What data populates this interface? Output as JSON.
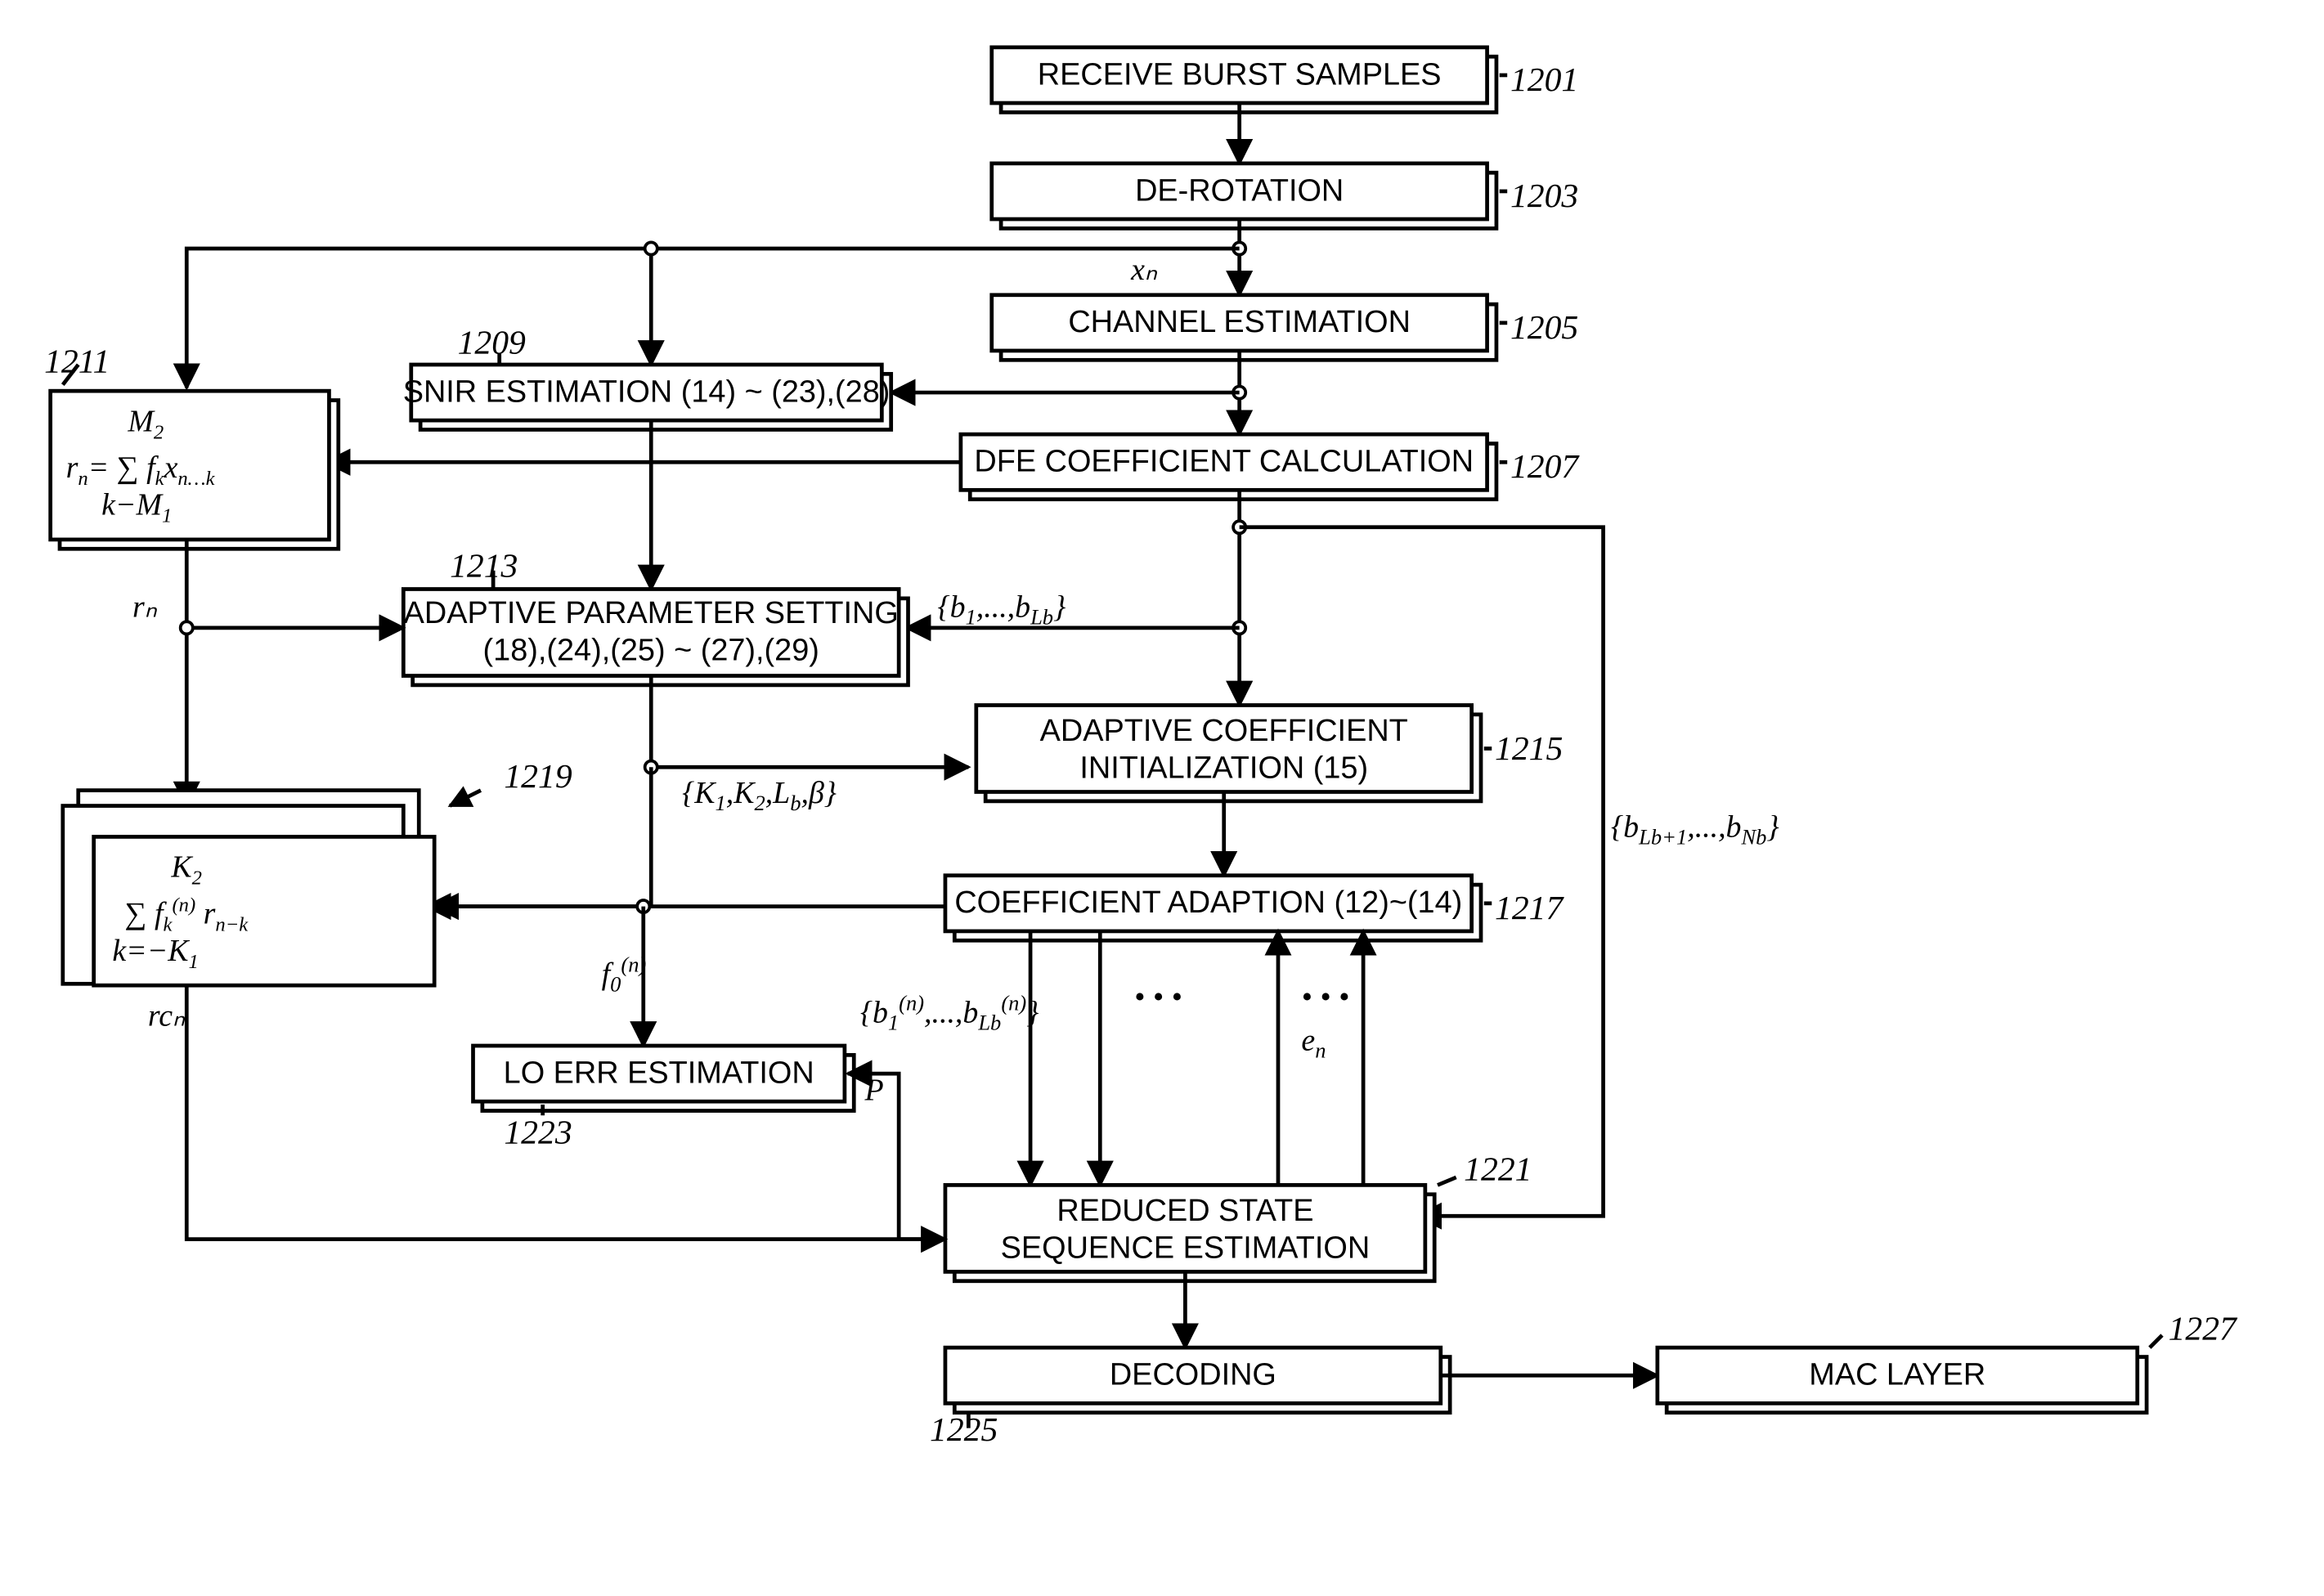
{
  "boxes": {
    "b1201": {
      "label": "RECEIVE BURST SAMPLES",
      "ref": "1201"
    },
    "b1203": {
      "label": "DE-ROTATION",
      "ref": "1203"
    },
    "b1205": {
      "label": "CHANNEL ESTIMATION",
      "ref": "1205"
    },
    "b1207": {
      "label": "DFE COEFFICIENT CALCULATION",
      "ref": "1207"
    },
    "b1209": {
      "label": "SNIR ESTIMATION (14) ~ (23),(28)",
      "ref": "1209"
    },
    "b1213": {
      "label1": "ADAPTIVE PARAMETER SETTING",
      "label2": "(18),(24),(25) ~ (27),(29)",
      "ref": "1213"
    },
    "b1215": {
      "label1": "ADAPTIVE COEFFICIENT",
      "label2": "INITIALIZATION (15)",
      "ref": "1215"
    },
    "b1217": {
      "label": "COEFFICIENT ADAPTION (12)~(14)",
      "ref": "1217"
    },
    "b1221": {
      "label1": "REDUCED STATE",
      "label2": "SEQUENCE ESTIMATION",
      "ref": "1221"
    },
    "b1223": {
      "label": "LO ERR ESTIMATION",
      "ref": "1223"
    },
    "b1225": {
      "label": "DECODING",
      "ref": "1225"
    },
    "b1227": {
      "label": "MAC LAYER",
      "ref": "1227"
    },
    "b1211": {
      "ref": "1211"
    },
    "b1219": {
      "ref": "1219"
    }
  },
  "edge_labels": {
    "xn": "xₙ",
    "rn": "rₙ",
    "rcn": "rcₙ",
    "b1_lb": "{b₁,...,b_Lb}",
    "k1k2": "{K₁,K₂,Lb,β}",
    "b_lb1_nb": "{b_Lb+1,...,b_Nb}",
    "f0n": "f₀⁽ⁿ⁾",
    "b1n": "{b₁⁽ⁿ⁾,...,b_Lb⁽ⁿ⁾}",
    "en": "eₙ",
    "dots": "• • •",
    "p": "P"
  }
}
